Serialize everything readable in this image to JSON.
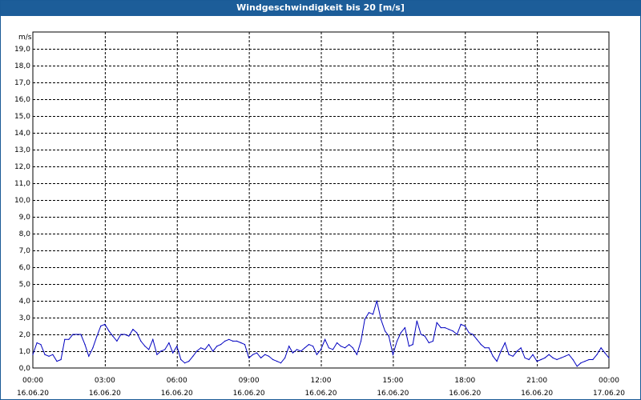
{
  "window": {
    "title": "Windgeschwindigkeit bis 20 [m/s]"
  },
  "chart_data": {
    "type": "line",
    "title": "Windgeschwindigkeit bis 20 [m/s]",
    "ylabel": "m/s",
    "ylim": [
      0,
      20
    ],
    "xlim_hours": [
      0,
      24
    ],
    "grid": true,
    "y_ticks": [
      "0,0",
      "1,0",
      "2,0",
      "3,0",
      "4,0",
      "5,0",
      "6,0",
      "7,0",
      "8,0",
      "9,0",
      "10,0",
      "11,0",
      "12,0",
      "13,0",
      "14,0",
      "15,0",
      "16,0",
      "17,0",
      "18,0",
      "19,0"
    ],
    "x_ticks": [
      {
        "time": "00:00",
        "date": "16.06.20"
      },
      {
        "time": "03:00",
        "date": "16.06.20"
      },
      {
        "time": "06:00",
        "date": "16.06.20"
      },
      {
        "time": "09:00",
        "date": "16.06.20"
      },
      {
        "time": "12:00",
        "date": "16.06.20"
      },
      {
        "time": "15:00",
        "date": "16.06.20"
      },
      {
        "time": "18:00",
        "date": "16.06.20"
      },
      {
        "time": "21:00",
        "date": "16.06.20"
      },
      {
        "time": "00:00",
        "date": "17.06.20"
      }
    ],
    "series": [
      {
        "color": "#0000c0",
        "x": [
          0.0,
          0.17,
          0.33,
          0.5,
          0.67,
          0.83,
          1.0,
          1.17,
          1.33,
          1.5,
          1.67,
          1.83,
          2.0,
          2.17,
          2.33,
          2.5,
          2.67,
          2.83,
          3.0,
          3.17,
          3.33,
          3.5,
          3.67,
          3.83,
          4.0,
          4.17,
          4.33,
          4.5,
          4.67,
          4.83,
          5.0,
          5.17,
          5.33,
          5.5,
          5.67,
          5.83,
          6.0,
          6.17,
          6.33,
          6.5,
          6.67,
          6.83,
          7.0,
          7.17,
          7.33,
          7.5,
          7.67,
          7.83,
          8.0,
          8.17,
          8.33,
          8.5,
          8.67,
          8.83,
          9.0,
          9.17,
          9.33,
          9.5,
          9.67,
          9.83,
          10.0,
          10.17,
          10.33,
          10.5,
          10.67,
          10.83,
          11.0,
          11.17,
          11.33,
          11.5,
          11.67,
          11.83,
          12.0,
          12.17,
          12.33,
          12.5,
          12.67,
          12.83,
          13.0,
          13.17,
          13.33,
          13.5,
          13.67,
          13.83,
          14.0,
          14.17,
          14.33,
          14.5,
          14.67,
          14.83,
          15.0,
          15.17,
          15.33,
          15.5,
          15.67,
          15.83,
          16.0,
          16.17,
          16.33,
          16.5,
          16.67,
          16.83,
          17.0,
          17.17,
          17.33,
          17.5,
          17.67,
          17.83,
          18.0,
          18.17,
          18.33,
          18.5,
          18.67,
          18.83,
          19.0,
          19.17,
          19.33,
          19.5,
          19.67,
          19.83,
          20.0,
          20.17,
          20.33,
          20.5,
          20.67,
          20.83,
          21.0,
          21.17,
          21.33,
          21.5,
          21.67,
          21.83,
          22.0,
          22.17,
          22.33,
          22.5,
          22.67,
          22.83,
          23.0,
          23.17,
          23.33,
          23.5,
          23.67,
          23.83,
          24.0
        ],
        "values": [
          0.8,
          1.5,
          1.4,
          0.8,
          0.7,
          0.8,
          0.4,
          0.5,
          1.7,
          1.7,
          2.0,
          2.0,
          2.0,
          1.4,
          0.7,
          1.2,
          1.9,
          2.5,
          2.6,
          2.2,
          1.9,
          1.6,
          2.0,
          2.0,
          1.9,
          2.3,
          2.1,
          1.6,
          1.3,
          1.1,
          1.7,
          0.8,
          1.0,
          1.1,
          1.5,
          0.9,
          1.3,
          0.5,
          0.3,
          0.4,
          0.7,
          1.0,
          1.2,
          1.1,
          1.4,
          1.0,
          1.3,
          1.4,
          1.6,
          1.7,
          1.6,
          1.6,
          1.5,
          1.4,
          0.6,
          0.8,
          0.9,
          0.6,
          0.8,
          0.7,
          0.5,
          0.4,
          0.3,
          0.6,
          1.3,
          0.9,
          1.1,
          1.0,
          1.2,
          1.4,
          1.3,
          0.8,
          1.1,
          1.7,
          1.2,
          1.1,
          1.5,
          1.3,
          1.2,
          1.4,
          1.2,
          0.8,
          1.6,
          2.9,
          3.3,
          3.2,
          4.0,
          2.9,
          2.2,
          1.9,
          0.8,
          1.6,
          2.1,
          2.4,
          1.3,
          1.4,
          2.8,
          2.0,
          1.9,
          1.5,
          1.6,
          2.7,
          2.4,
          2.4,
          2.3,
          2.2,
          2.0,
          2.6,
          2.5,
          2.1,
          2.0,
          1.7,
          1.4,
          1.2,
          1.2,
          0.7,
          0.4,
          1.0,
          1.5,
          0.8,
          0.7,
          1.0,
          1.2,
          0.6,
          0.5,
          0.8,
          0.4,
          0.5,
          0.6,
          0.8,
          0.6,
          0.5,
          0.6,
          0.7,
          0.8,
          0.5,
          0.1,
          0.3,
          0.4,
          0.5,
          0.5,
          0.8,
          1.2,
          0.9,
          0.6
        ]
      }
    ]
  }
}
